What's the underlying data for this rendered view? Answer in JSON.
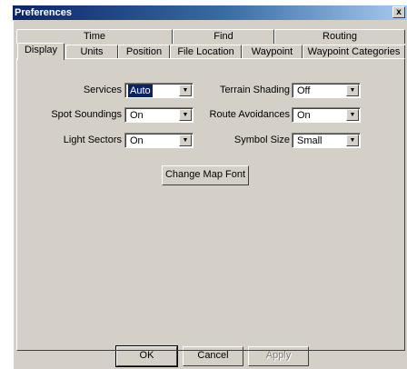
{
  "window": {
    "title": "Preferences",
    "close_glyph": "x"
  },
  "tabs": {
    "row_back": [
      "Time",
      "Find",
      "Routing"
    ],
    "row_front": [
      "Display",
      "Units",
      "Position",
      "File Location",
      "Waypoint",
      "Waypoint Categories"
    ],
    "selected": "Display"
  },
  "fields": {
    "services": {
      "label": "Services",
      "value": "Auto"
    },
    "spot_soundings": {
      "label": "Spot Soundings",
      "value": "On"
    },
    "light_sectors": {
      "label": "Light Sectors",
      "value": "On"
    },
    "terrain_shading": {
      "label": "Terrain Shading",
      "value": "Off"
    },
    "route_avoidances": {
      "label": "Route Avoidances",
      "value": "On"
    },
    "symbol_size": {
      "label": "Symbol Size",
      "value": "Small"
    }
  },
  "change_font_button": "Change Map Font",
  "footer": {
    "ok": "OK",
    "cancel": "Cancel",
    "apply": "Apply"
  },
  "icons": {
    "dropdown": "chevron-down-icon",
    "close": "close-icon"
  },
  "colors": {
    "titlebar_start": "#0a246a",
    "titlebar_end": "#a6caf0",
    "face": "#d4d0c8",
    "selection": "#0a246a"
  }
}
